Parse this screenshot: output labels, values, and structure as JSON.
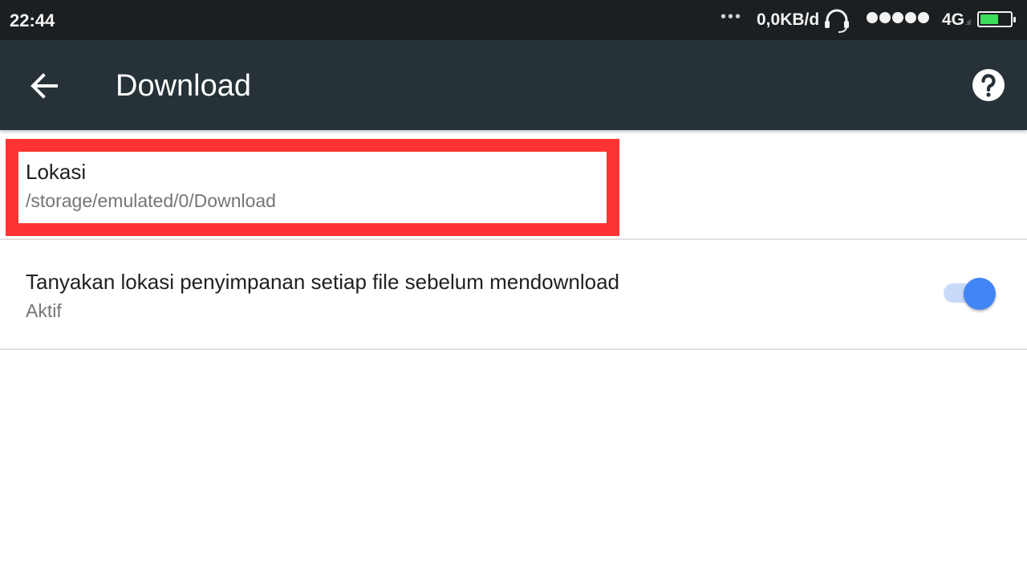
{
  "status_bar": {
    "time": "22:44",
    "overflow_dots": "•••",
    "speed": "0,0KB/d",
    "network": "4G",
    "network_suffix": ".ıl",
    "battery_level": 0.62,
    "battery_color": "#3ddc5a"
  },
  "app_bar": {
    "title": "Download",
    "back_icon": "arrow-left-icon",
    "help_icon": "help-circle-icon",
    "background": "#263238"
  },
  "settings": {
    "location": {
      "title": "Lokasi",
      "value": "/storage/emulated/0/Download",
      "highlight_color": "#ff3333"
    },
    "ask_location": {
      "title": "Tanyakan lokasi penyimpanan setiap file sebelum mendownload",
      "status": "Aktif",
      "toggle_on": true,
      "accent": "#4285f4"
    }
  }
}
